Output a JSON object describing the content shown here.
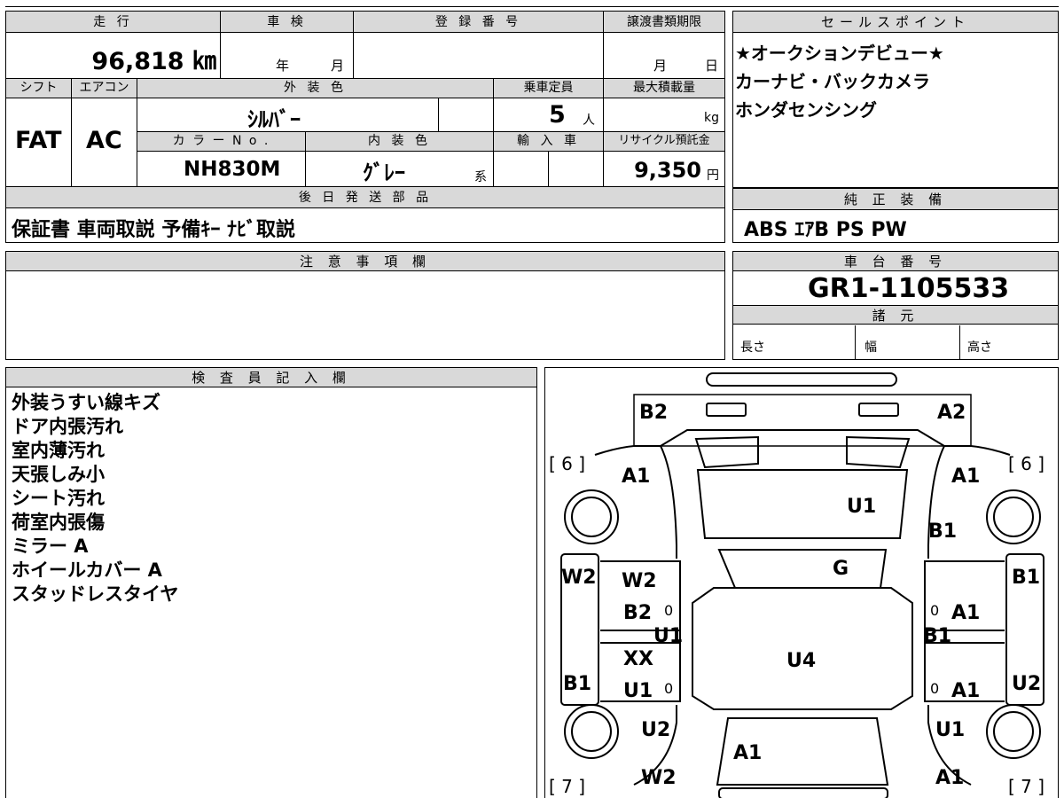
{
  "labels": {
    "mileage": "走 行",
    "inspection": "車 検",
    "registration": "登 録 番 号",
    "transfer_deadline": "譲渡書類期限",
    "sales_point": "セールスポイント",
    "shift": "シフト",
    "aircon": "エアコン",
    "exterior_color": "外 装 色",
    "capacity": "乗車定員",
    "max_load": "最大積載量",
    "color_no": "カ ラ ー N o .",
    "interior_color": "内 装 色",
    "import": "輸 入 車",
    "recycle": "リサイクル預託金",
    "later_parts": "後 日 発 送 部 品",
    "genuine_equipment": "純 正 装 備",
    "notes": "注 意 事 項 欄",
    "chassis_no": "車 台 番 号",
    "specs": "諸 元",
    "length": "長さ",
    "width": "幅",
    "height": "高さ",
    "inspector": "検 査 員 記 入 欄"
  },
  "values": {
    "mileage": "96,818 ㎞",
    "inspection_year": "年",
    "inspection_month": "月",
    "deadline_month": "月",
    "deadline_day": "日",
    "shift": "FAT",
    "aircon": "AC",
    "exterior_color": "ｼﾙﾊﾞｰ",
    "capacity": "5",
    "capacity_unit": "人",
    "max_load_unit": "kg",
    "color_no": "NH830M",
    "interior_color": "ｸﾞﾚｰ",
    "interior_suffix": "系",
    "recycle": "9,350",
    "recycle_unit": "円",
    "later_parts": "保証書 車両取説 予備ｷｰ ﾅﾋﾞ取説",
    "genuine_equipment": "ABS ｴｱB PS PW",
    "chassis_no": "GR1-1105533"
  },
  "sales_points": [
    "★オークションデビュー★",
    "カーナビ・バックカメラ",
    "ホンダセンシング"
  ],
  "inspector_notes": [
    "外装うすい線キズ",
    "ドア内張汚れ",
    "室内薄汚れ",
    "天張しみ小",
    "シート汚れ",
    "荷室内張傷",
    "ミラー A",
    "ホイールカバー A",
    "スタッドレスタイヤ"
  ],
  "diagram": {
    "top_left": "B2",
    "top_right": "A2",
    "bracket_tl": "[ 6 ]",
    "bracket_tr": "[ 6 ]",
    "bracket_bl": "[ 7 ]",
    "bracket_br": "[ 7 ]",
    "front_left_fender": "A1",
    "front_right_fender": "A1",
    "roof": "U1",
    "right_pillar": "B1",
    "glass": "G",
    "left_side": "W2",
    "left_door_upper": "W2",
    "left_door_b2": "B2",
    "left_u1_mid": "U1",
    "left_xx": "XX",
    "left_b1": "B1",
    "left_u1_low": "U1",
    "right_b1_side": "B1",
    "right_a1_upper": "A1",
    "right_b1_mid": "B1",
    "right_a1_low": "A1",
    "right_u2": "U2",
    "center_u4": "U4",
    "rear_left_u2": "U2",
    "rear_center_a1": "A1",
    "rear_left_w2": "W2",
    "rear_right_u1": "U1",
    "rear_right_a1": "A1",
    "zero1": "0",
    "zero2": "0",
    "zero3": "0",
    "zero4": "0"
  }
}
